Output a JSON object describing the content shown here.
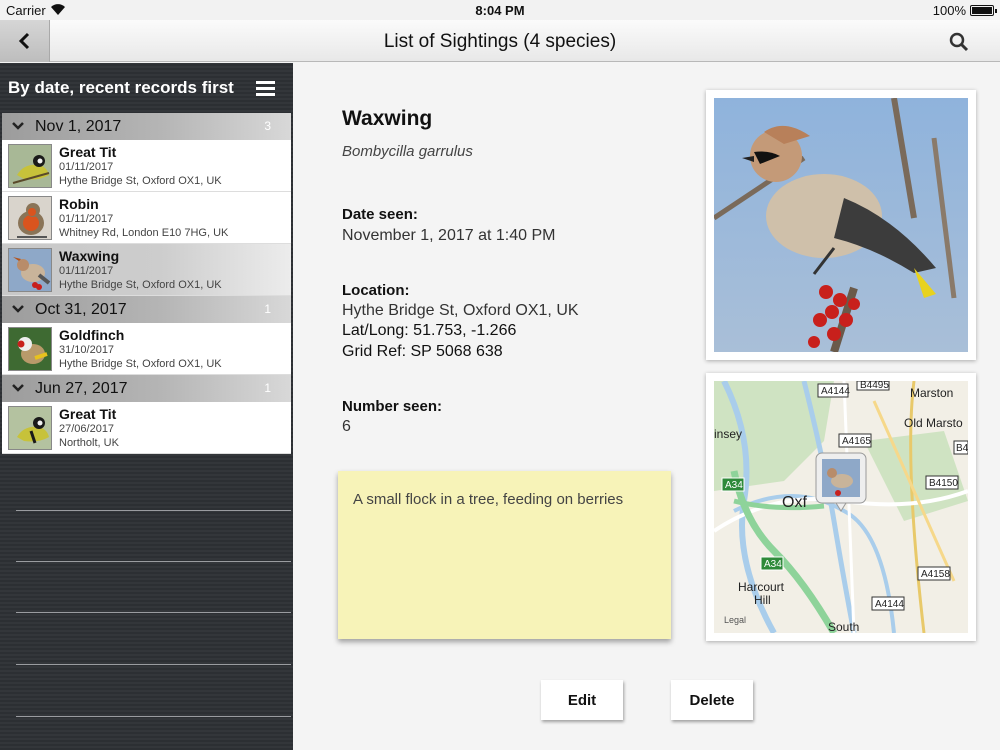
{
  "status": {
    "carrier": "Carrier",
    "time": "8:04 PM",
    "battery": "100%"
  },
  "nav": {
    "title": "List of Sightings (4 species)"
  },
  "sidebar": {
    "sort_label": "By date, recent records first",
    "groups": [
      {
        "date": "Nov 1, 2017",
        "count": "3",
        "items": [
          {
            "name": "Great Tit",
            "date": "01/11/2017",
            "location": "Hythe Bridge St, Oxford OX1, UK"
          },
          {
            "name": "Robin",
            "date": "01/11/2017",
            "location": "Whitney Rd, London E10 7HG, UK"
          },
          {
            "name": "Waxwing",
            "date": "01/11/2017",
            "location": "Hythe Bridge St, Oxford OX1, UK"
          }
        ]
      },
      {
        "date": "Oct 31, 2017",
        "count": "1",
        "items": [
          {
            "name": "Goldfinch",
            "date": "31/10/2017",
            "location": "Hythe Bridge St, Oxford OX1, UK"
          }
        ]
      },
      {
        "date": "Jun 27, 2017",
        "count": "1",
        "items": [
          {
            "name": "Great Tit",
            "date": "27/06/2017",
            "location": "Northolt, UK"
          }
        ]
      }
    ]
  },
  "detail": {
    "species": "Waxwing",
    "latin": "Bombycilla garrulus",
    "date_label": "Date seen:",
    "date_value": "November 1, 2017 at 1:40 PM",
    "location_label": "Location:",
    "location_value": "Hythe Bridge St, Oxford OX1, UK",
    "latlong": "Lat/Long: 51.753, -1.266",
    "gridref": "Grid Ref: SP 5068 638",
    "number_label": "Number seen:",
    "number_value": "6",
    "note": "A small flock in a tree, feeding on berries",
    "map_labels": {
      "a4144_top": "A4144",
      "b4495": "B4495",
      "marston": "Marston",
      "old_marston": "Old Marsto",
      "ney": "insey",
      "a4165": "A4165",
      "b4": "B4",
      "b4150": "B4150",
      "a34_top": "A34",
      "oxford": "Oxf",
      "a34_bottom": "A34",
      "harcourt": "Harcourt",
      "hill": "Hill",
      "a4158": "A4158",
      "a4144_bottom": "A4144",
      "legal": "Legal",
      "south": "South"
    },
    "edit_label": "Edit",
    "delete_label": "Delete"
  },
  "colors": {
    "accent_green": "#3a8a3a",
    "note_yellow": "#f7f3b8",
    "sidebar_dark": "#2e3135"
  }
}
